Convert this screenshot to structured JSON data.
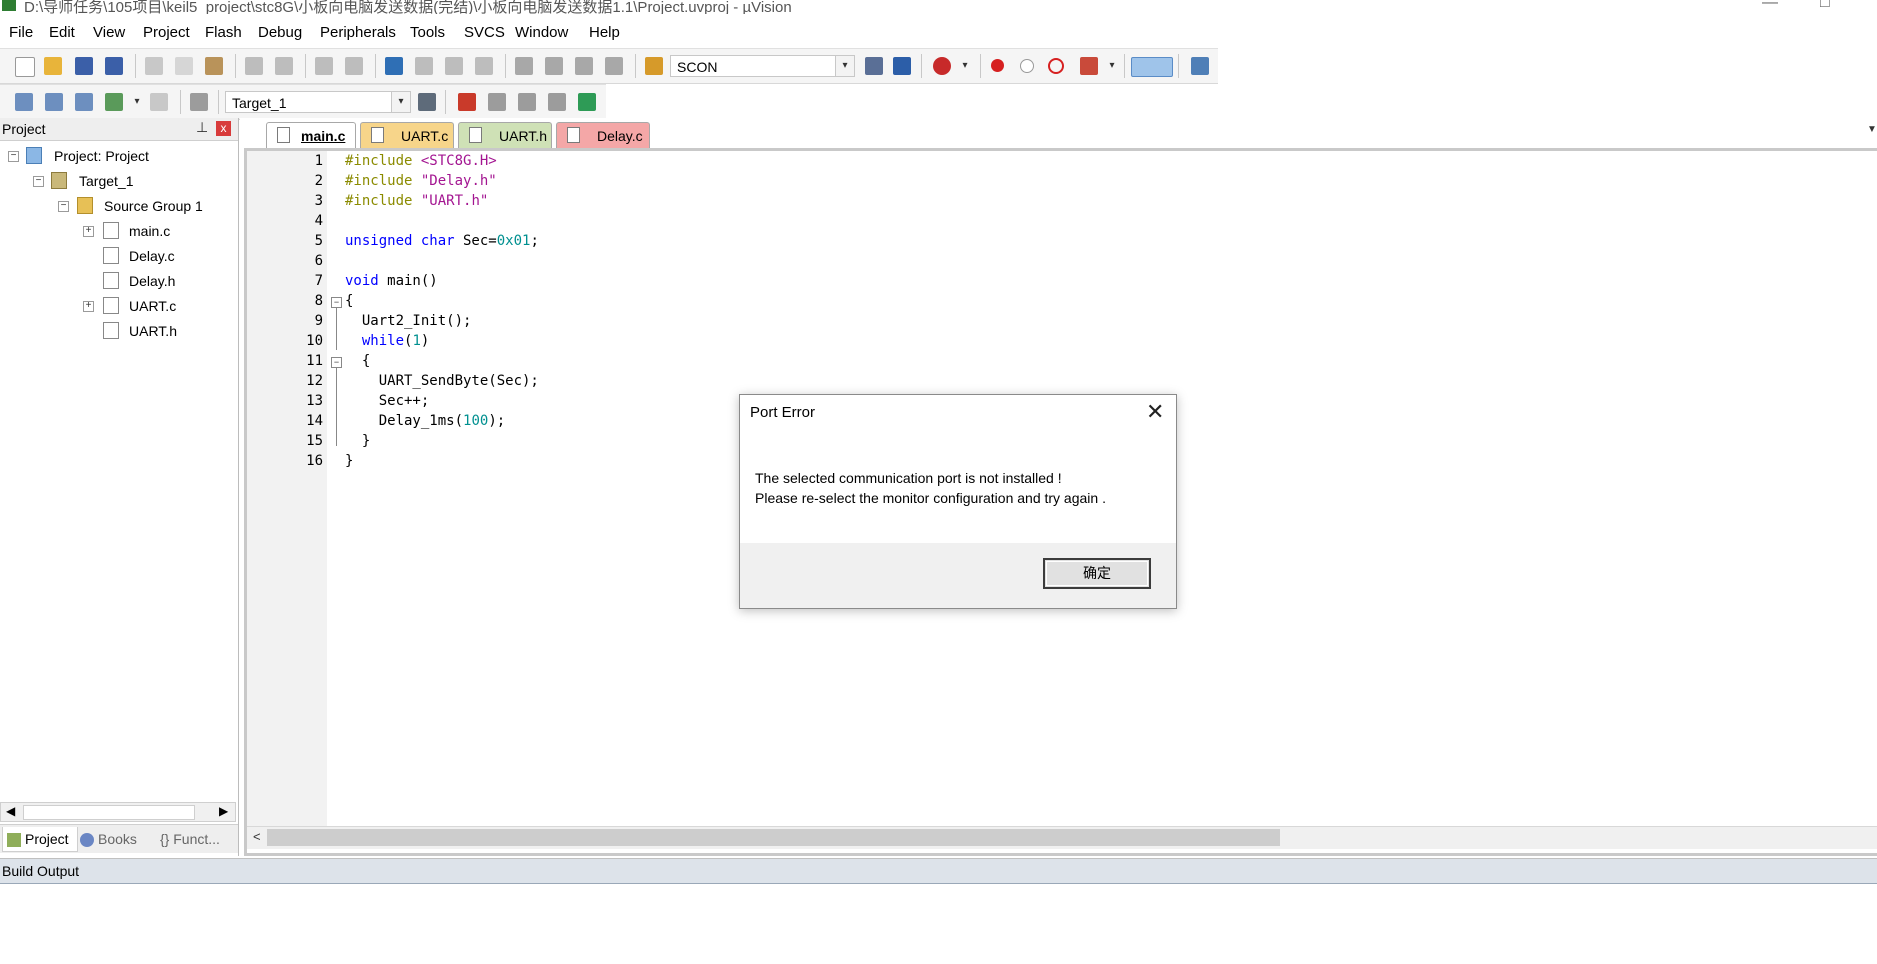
{
  "window": {
    "title": "D:\\导师任务\\105项目\\keil5_project\\stc8G\\小板向电脑发送数据(完结)\\小板向电脑发送数据1.1\\Project.uvproj - µVision",
    "minimize_symbol": "—",
    "maximize_symbol": "□"
  },
  "menu": [
    "File",
    "Edit",
    "View",
    "Project",
    "Flash",
    "Debug",
    "Peripherals",
    "Tools",
    "SVCS",
    "Window",
    "Help"
  ],
  "toolbar": {
    "find_combo_value": "SCON",
    "target_combo_value": "Target_1",
    "combo_arrow": "▾"
  },
  "project_panel": {
    "title": "Project",
    "pin_symbol": "⊥",
    "close_symbol": "x",
    "tree": {
      "root": "Project: Project",
      "target": "Target_1",
      "group": "Source Group 1",
      "files": [
        "main.c",
        "Delay.c",
        "Delay.h",
        "UART.c",
        "UART.h"
      ]
    },
    "expander_minus": "−",
    "expander_plus": "+",
    "tabs": [
      "Project",
      "Books",
      "{} Funct..."
    ]
  },
  "editor": {
    "tabs": [
      "main.c",
      "UART.c",
      "UART.h",
      "Delay.c"
    ],
    "tab_colors": [
      "#ffffff",
      "#f7d58a",
      "#cfe1b6",
      "#f4a7a7"
    ],
    "line_numbers": [
      "1",
      "2",
      "3",
      "4",
      "5",
      "6",
      "7",
      "8",
      "9",
      "10",
      "11",
      "12",
      "13",
      "14",
      "15",
      "16"
    ],
    "code": {
      "l1_kw": "#include",
      "l1_str": " <STC8G.H>",
      "l2_kw": "#include",
      "l2_str": " \"Delay.h\"",
      "l3_kw": "#include",
      "l3_str": " \"UART.h\"",
      "l5_kw": "unsigned char",
      "l5_txt": " Sec=",
      "l5_num": "0x01",
      "l5_end": ";",
      "l7_kw": "void",
      "l7_txt": " main()",
      "l8": "{",
      "l9": "  Uart2_Init();",
      "l10_kw": "  while",
      "l10_txt": "(",
      "l10_num": "1",
      "l10_end": ")",
      "l11": "  {",
      "l12": "    UART_SendByte(Sec);",
      "l13": "    Sec++;",
      "l14_txt": "    Delay_1ms(",
      "l14_num": "100",
      "l14_end": ");",
      "l15": "  }",
      "l16": "}"
    },
    "fold_minus": "−",
    "scroll_left": "<"
  },
  "build_output": {
    "title": "Build Output"
  },
  "dialog": {
    "title": "Port Error",
    "close_symbol": "✕",
    "line1": "The selected communication port is not installed !",
    "line2": "Please re-select the monitor configuration and try again .",
    "ok_label": "确定"
  },
  "colors": {
    "accent": "#0078d7",
    "error_red": "#d83b3b"
  },
  "icons": [
    "new-file-icon",
    "open-icon",
    "save-icon",
    "save-all-icon",
    "cut-icon",
    "copy-icon",
    "paste-icon",
    "undo-icon",
    "redo-icon",
    "back-icon",
    "forward-icon",
    "bookmark-icon",
    "indent-icon",
    "comment-icon",
    "find-icon",
    "debug-icon",
    "breakpoint-icon",
    "window-icon",
    "wrench-icon",
    "build-icon",
    "rebuild-icon",
    "load-icon",
    "options-icon"
  ]
}
